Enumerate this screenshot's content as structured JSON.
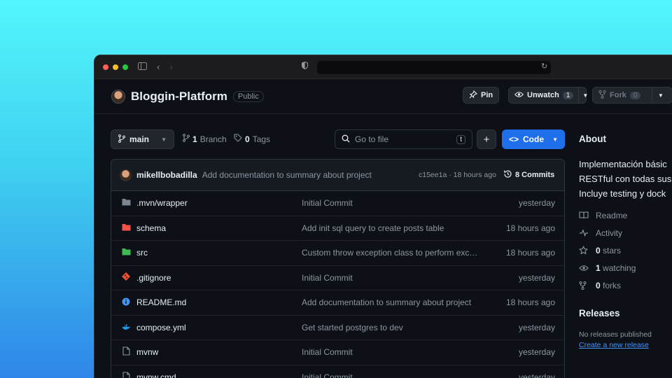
{
  "browser": {
    "traffic_lights": [
      "#ff5f57",
      "#febc2e",
      "#28c840"
    ],
    "sidebar_icon": "sidebar-icon",
    "back_icon": "chevron-left-icon",
    "forward_icon": "chevron-right-icon",
    "shield_icon": "shield-icon",
    "reload_icon": "reload-icon",
    "url": ""
  },
  "repo": {
    "name": "Bloggin-Platform",
    "visibility": "Public",
    "pin_label": "Pin",
    "unwatch_label": "Unwatch",
    "watch_count": "1",
    "fork_label": "Fork",
    "fork_count": "0"
  },
  "toolbar": {
    "branch": "main",
    "branch_count": "1",
    "branch_label": "Branch",
    "tag_count": "0",
    "tag_label": "Tags",
    "search_placeholder": "Go to file",
    "search_shortcut": "t",
    "add_label": "+",
    "code_label": "Code"
  },
  "commit": {
    "author": "mikellbobadilla",
    "message": "Add documentation to summary about project",
    "meta": "c15ee1a · 18 hours ago",
    "count_label": "8 Commits"
  },
  "files": [
    {
      "icon": "folder-icon",
      "name": ".mvn/wrapper",
      "message": "Initial Commit",
      "date": "yesterday"
    },
    {
      "icon": "folder-icon",
      "name": "schema",
      "message": "Add init sql query to create posts table",
      "date": "18 hours ago"
    },
    {
      "icon": "folder-icon",
      "name": "src",
      "message": "Custom throw exception class to perform exc…",
      "date": "18 hours ago"
    },
    {
      "icon": "git-icon",
      "name": ".gitignore",
      "message": "Initial Commit",
      "date": "yesterday"
    },
    {
      "icon": "info-icon",
      "name": "README.md",
      "message": "Add documentation to summary about project",
      "date": "18 hours ago"
    },
    {
      "icon": "docker-icon",
      "name": "compose.yml",
      "message": "Get started postgres to dev",
      "date": "yesterday"
    },
    {
      "icon": "file-icon",
      "name": "mvnw",
      "message": "Initial Commit",
      "date": "yesterday"
    },
    {
      "icon": "file-icon",
      "name": "mvnw.cmd",
      "message": "Initial Commit",
      "date": "yesterday"
    }
  ],
  "about": {
    "title": "About",
    "description": [
      "Implementación básic",
      "RESTful con todas sus",
      "Incluye testing y dock"
    ],
    "stats": [
      {
        "icon": "book-icon",
        "count": "",
        "label": "Readme"
      },
      {
        "icon": "pulse-icon",
        "count": "",
        "label": "Activity"
      },
      {
        "icon": "star-icon",
        "count": "0",
        "label": "stars"
      },
      {
        "icon": "eye-icon",
        "count": "1",
        "label": "watching"
      },
      {
        "icon": "fork-icon",
        "count": "0",
        "label": "forks"
      }
    ],
    "releases_title": "Releases",
    "releases_none": "No releases published",
    "releases_link": "Create a new release"
  },
  "colors": {
    "accent": "#1f6feb",
    "link": "#4493f8",
    "background": "#0d1117"
  }
}
